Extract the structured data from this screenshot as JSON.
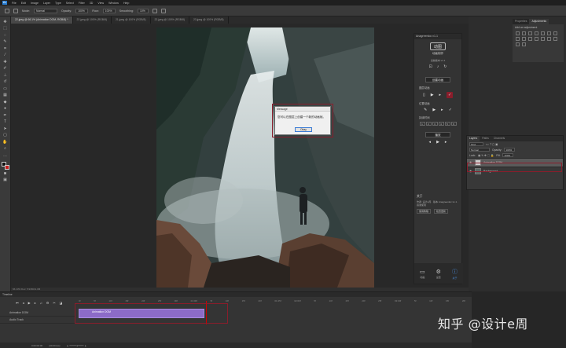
{
  "menubar": {
    "logo": "Ps",
    "items": [
      "File",
      "Edit",
      "Image",
      "Layer",
      "Type",
      "Select",
      "Filter",
      "3D",
      "View",
      "Window",
      "Help"
    ]
  },
  "options": {
    "mode_label": "Mode:",
    "mode_value": "Normal",
    "opacity_label": "Opacity:",
    "opacity_value": "100%",
    "flow_label": "Flow:",
    "flow_value": "100%",
    "smooth_label": "Smoothing:",
    "smooth_value": "10%"
  },
  "tabs": [
    "22.jpeg @ 66.1% (Animation DOM, RGB/8) *",
    "22.jpeg @ 100% (RGB/8)",
    "21.jpeg @ 100% (RGB/8)",
    "22.jpeg @ 100% (RGB/8)",
    "23.jpeg @ 100% (RGB/8)"
  ],
  "dialog": {
    "title": "Message",
    "message": "您可以在图层上创建一个新的动画帧。",
    "ok": "Okay"
  },
  "plugin": {
    "header": "Anagreenloc v1.1",
    "brand_logo": "动图",
    "brand_name": "动画制作",
    "version_note": "当前版本 v1.1",
    "create_btn": "创建动画",
    "section1": "图层动画",
    "section2": "位置动画",
    "section3": "持续时间",
    "numbers": [
      "1",
      "2",
      "3",
      "4",
      "5",
      "6"
    ],
    "play_btn": "播放",
    "about_title": "关于",
    "about_text": "作者: 设计e周 · 版本 Anagreenloc v1.1 · 感谢使用",
    "link1": "使用教程",
    "link2": "检查更新",
    "footer": [
      {
        "label": "动画",
        "icon": "monitor-icon"
      },
      {
        "label": "设置",
        "icon": "gear-icon"
      },
      {
        "label": "关于",
        "icon": "info-icon"
      }
    ]
  },
  "right": {
    "tab1": "Properties",
    "tab2": "Adjustments",
    "adjust_title": "Add an adjustment"
  },
  "layers": {
    "tab_layers": "Layers",
    "tab_paths": "Paths",
    "tab_channels": "Channels",
    "kind_label": "Kind",
    "blend": "Normal",
    "opacity_label": "Opacity:",
    "opacity_value": "100%",
    "lock_label": "Lock:",
    "fill_label": "Fill:",
    "fill_value": "100%",
    "items": [
      {
        "name": "Animation DOM",
        "selected": true
      },
      {
        "name": "Background",
        "selected": false
      }
    ]
  },
  "status": "66.13%    Doc: 5.93M/11.0M",
  "timeline": {
    "title": "Timeline",
    "ruler": [
      "0f",
      "5f",
      "10f",
      "15f",
      "20f",
      "25f",
      "30f",
      "01:00f",
      "5f",
      "10f",
      "15f",
      "20f",
      "01:25f",
      "02:00f",
      "5f",
      "10f",
      "15f",
      "20f",
      "25f",
      "03:00f",
      "5f",
      "10f",
      "15f",
      "20f"
    ],
    "track1": "Animation DOM",
    "track2": "Audio Track",
    "clip_label": "Animation DOM",
    "timecode": "0:00:00:00",
    "fps": "(30.00 fps)"
  },
  "watermark": "知乎 @设计e周"
}
